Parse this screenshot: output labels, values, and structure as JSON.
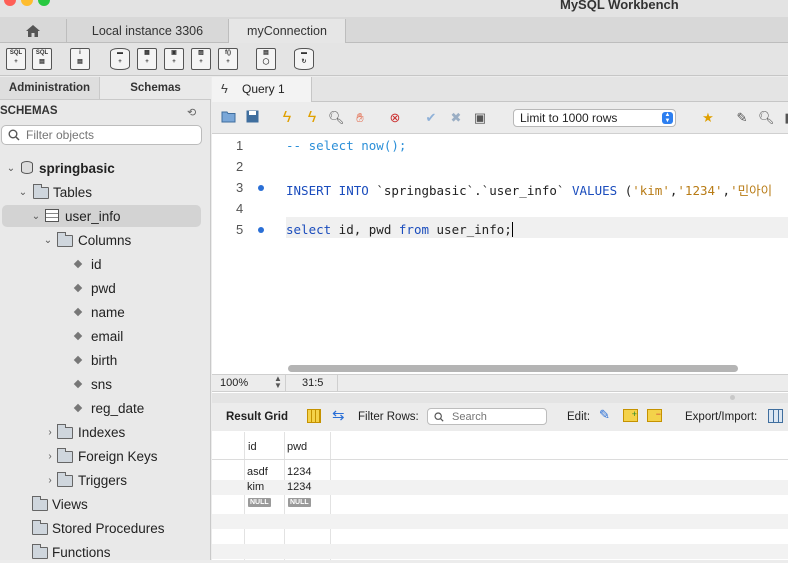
{
  "app": {
    "title": "MySQL Workbench"
  },
  "connection_tabs": [
    {
      "label": "Local instance 3306"
    },
    {
      "label": "myConnection"
    }
  ],
  "sidebar": {
    "tabs": [
      "Administration",
      "Schemas"
    ],
    "section_title": "SCHEMAS",
    "filter_placeholder": "Filter objects",
    "tree": {
      "schema": "springbasic",
      "tables_label": "Tables",
      "table": "user_info",
      "columns_label": "Columns",
      "columns": [
        "id",
        "pwd",
        "name",
        "email",
        "birth",
        "sns",
        "reg_date"
      ],
      "table_groups": [
        "Indexes",
        "Foreign Keys",
        "Triggers"
      ],
      "schema_groups": [
        "Views",
        "Stored Procedures",
        "Functions"
      ]
    }
  },
  "query": {
    "tab_label": "Query 1",
    "limit_label": "Limit to 1000 rows",
    "lines": [
      {
        "n": "1",
        "text": "-- select now();"
      },
      {
        "n": "2",
        "text": ""
      },
      {
        "n": "3",
        "kw1": "INSERT INTO ",
        "ident": "`springbasic`.`user_info`",
        "kw2": " VALUES ",
        "rest": "(",
        "s1": "'kim'",
        "c1": ",",
        "s2": "'1234'",
        "c2": ",",
        "s3": "'민아이"
      },
      {
        "n": "4",
        "text": ""
      },
      {
        "n": "5",
        "kw1": "select",
        "mid": " id, pwd ",
        "kw2": "from",
        "tail": " user_info;"
      }
    ]
  },
  "status": {
    "zoom": "100%",
    "position": "31:5"
  },
  "results": {
    "toolbar": {
      "grid_label": "Result Grid",
      "filter_label": "Filter Rows:",
      "search_placeholder": "Search",
      "edit_label": "Edit:",
      "export_label": "Export/Import:"
    },
    "columns": [
      "id",
      "pwd"
    ],
    "rows": [
      [
        "asdf",
        "1234"
      ],
      [
        "kim",
        "1234"
      ],
      [
        "NULL",
        "NULL"
      ]
    ]
  },
  "colors": {
    "accent": "#2a6fd6",
    "keyword": "#1b4dbd",
    "comment": "#2b8fd8",
    "string": "#b87b15"
  }
}
